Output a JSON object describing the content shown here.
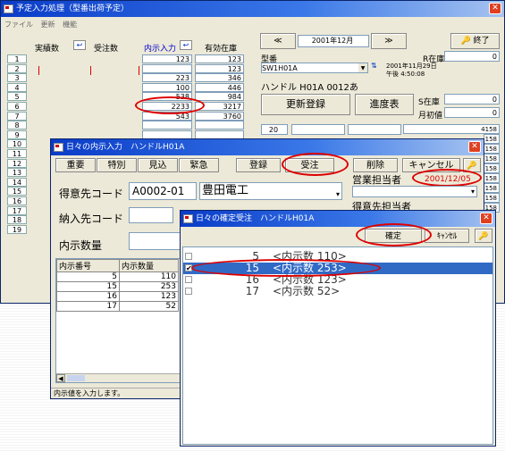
{
  "main": {
    "title": "予定入力処理（型番出荷予定）",
    "menu": [
      "ファイル",
      "更新",
      "機能"
    ],
    "columns": [
      "実績数",
      "受注数",
      "内示入力",
      "有効在庫"
    ],
    "rows": [
      {
        "num": "1",
        "val": "123",
        "stock": "123"
      },
      {
        "num": "2",
        "val": "",
        "stock": "123"
      },
      {
        "num": "3",
        "val": "223",
        "stock": "346"
      },
      {
        "num": "4",
        "val": "100",
        "stock": "446"
      },
      {
        "num": "5",
        "val": "538",
        "stock": "984"
      },
      {
        "num": "6",
        "val": "2233",
        "stock": "3217"
      },
      {
        "num": "7",
        "val": "543",
        "stock": "3760"
      },
      {
        "num": "8",
        "val": "",
        "stock": ""
      },
      {
        "num": "9",
        "val": "",
        "stock": ""
      },
      {
        "num": "10",
        "val": "",
        "stock": ""
      },
      {
        "num": "11",
        "val": "",
        "stock": ""
      },
      {
        "num": "12",
        "val": "",
        "stock": ""
      },
      {
        "num": "13",
        "val": "",
        "stock": ""
      },
      {
        "num": "14",
        "val": "",
        "stock": ""
      },
      {
        "num": "15",
        "val": "",
        "stock": ""
      },
      {
        "num": "16",
        "val": "",
        "stock": ""
      },
      {
        "num": "17",
        "val": "",
        "stock": ""
      },
      {
        "num": "18",
        "val": "",
        "stock": ""
      },
      {
        "num": "19",
        "val": "",
        "stock": ""
      }
    ],
    "month_prev": "≪",
    "month_label": "2001年12月",
    "month_next": "≫",
    "end_button": "終了",
    "model_label": "型番",
    "model_value": "SW1H01A",
    "r_stock_label": "R在庫",
    "r_stock_value": "0",
    "date_info": "2001年11月29日",
    "time_info": "午後 4:50:08",
    "product_name": "ハンドル H01A 0012あ",
    "update_button": "更新登録",
    "progress_button": "進度表",
    "s_stock_label": "S在庫",
    "s_stock_value": "0",
    "month_start_label": "月初値",
    "month_start_value": "0",
    "right_values": [
      "4158",
      "158",
      "158",
      "158",
      "158",
      "158",
      "158",
      "158",
      "158"
    ],
    "small_field": "20"
  },
  "naiji": {
    "title": "日々の内示入力　ハンドルH01A",
    "buttons": [
      "重要",
      "特別",
      "見込",
      "緊急",
      "登録",
      "受注",
      "削除",
      "キャンセル"
    ],
    "customer_label": "得意先コード",
    "customer_code": "A0002-01",
    "customer_name": "豊田電工",
    "sales_rep_label": "営業担当者",
    "date_value": "2001/12/05",
    "customer_rep_label": "得意先担当者",
    "delivery_label": "納入先コード",
    "quantity_label": "内示数量",
    "list_headers": [
      "内示番号",
      "内示数量"
    ],
    "list_rows": [
      {
        "no": "5",
        "qty": "110"
      },
      {
        "no": "15",
        "qty": "253"
      },
      {
        "no": "16",
        "qty": "123"
      },
      {
        "no": "17",
        "qty": "52"
      }
    ],
    "status_text": "内示値を入力します。"
  },
  "kakutei": {
    "title": "日々の確定受注　ハンドルH01A",
    "confirm_button": "確定",
    "cancel_button": "ｷｬﾝｾﾙ",
    "items": [
      {
        "no": "5",
        "text": "<内示数 110>",
        "checked": false,
        "selected": false
      },
      {
        "no": "15",
        "text": "<内示数 253>",
        "checked": true,
        "selected": true
      },
      {
        "no": "16",
        "text": "<内示数 123>",
        "checked": false,
        "selected": false
      },
      {
        "no": "17",
        "text": "<内示数 52>",
        "checked": false,
        "selected": false
      }
    ]
  },
  "colors": {
    "title_bar": "#0a3cc8",
    "window_bg": "#ece9d8",
    "selection": "#316ac5",
    "highlight": "#d00000"
  }
}
